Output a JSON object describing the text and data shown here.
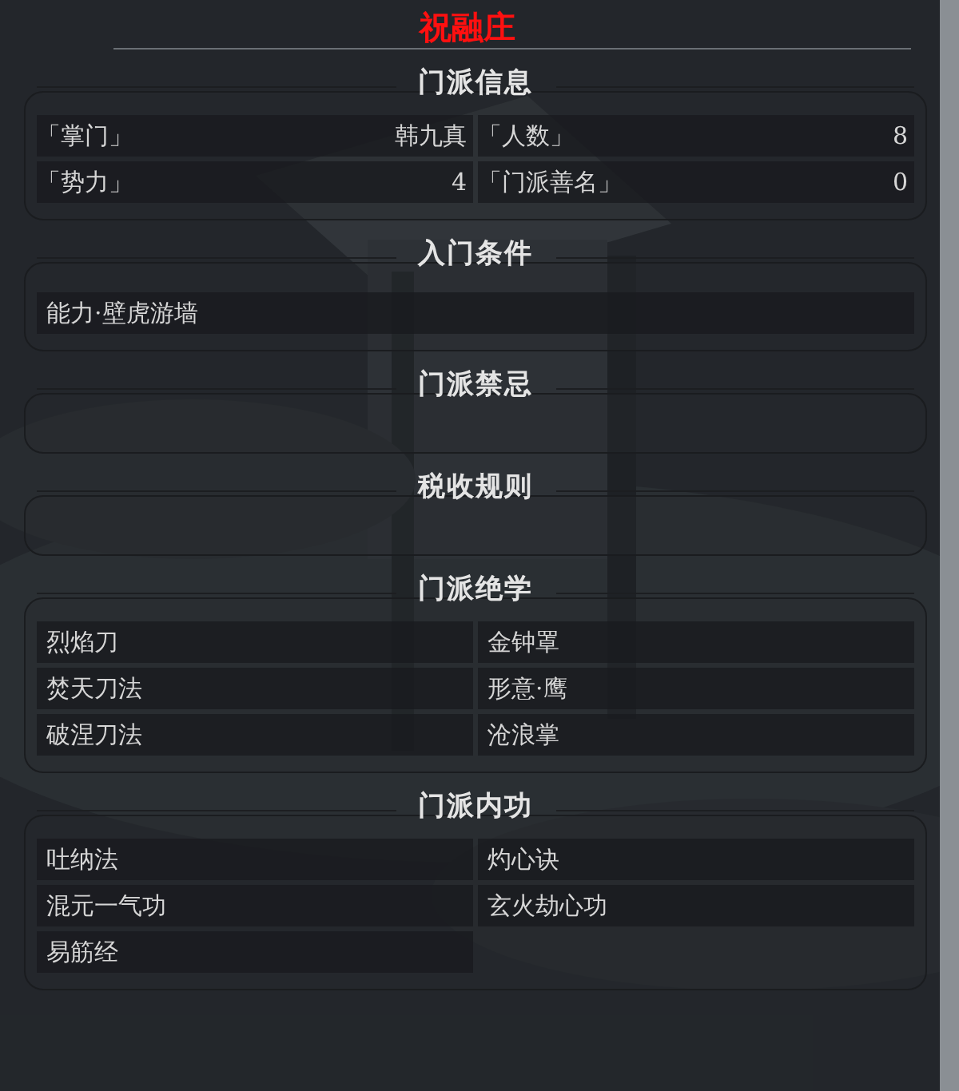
{
  "title": "祝融庄",
  "sections": [
    {
      "kind": "fields",
      "heading": "门派信息",
      "fields": [
        {
          "label": "「掌门」",
          "value": "韩九真"
        },
        {
          "label": "「人数」",
          "value": "8"
        },
        {
          "label": "「势力」",
          "value": "4"
        },
        {
          "label": "「门派善名」",
          "value": "0"
        }
      ]
    },
    {
      "kind": "single",
      "heading": "入门条件",
      "items": [
        "能力·壁虎游墙"
      ]
    },
    {
      "kind": "empty",
      "heading": "门派禁忌"
    },
    {
      "kind": "empty",
      "heading": "税收规则"
    },
    {
      "kind": "grid",
      "heading": "门派绝学",
      "items": [
        "烈焰刀",
        "金钟罩",
        "焚天刀法",
        "形意·鹰",
        "破涅刀法",
        "沧浪掌"
      ]
    },
    {
      "kind": "grid",
      "heading": "门派内功",
      "items": [
        "吐纳法",
        "灼心诀",
        "混元一气功",
        "玄火劫心功",
        "易筋经"
      ]
    }
  ]
}
